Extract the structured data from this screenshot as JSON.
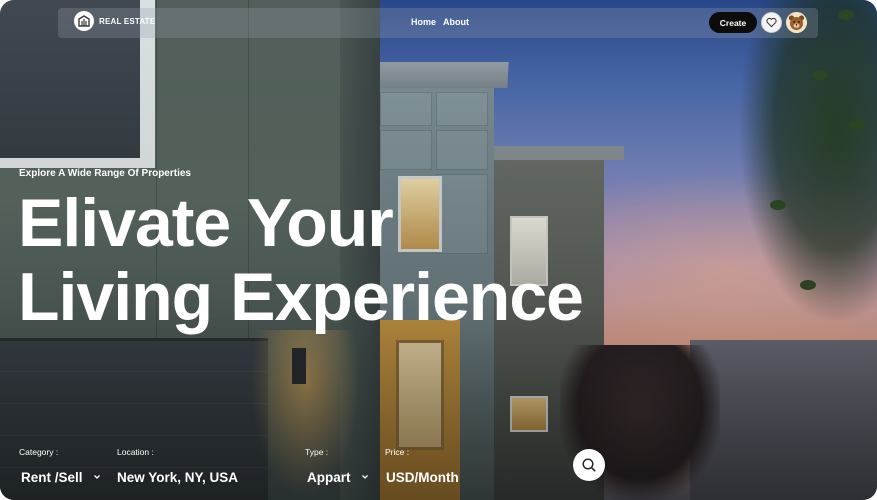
{
  "nav": {
    "brand": "REAL ESTATE",
    "links": [
      {
        "label": "Home"
      },
      {
        "label": "About"
      }
    ],
    "create_label": "Create",
    "favorite_icon": "heart-icon",
    "avatar_icon": "bear-avatar"
  },
  "hero": {
    "eyebrow": "Explore A Wide Range Of Properties",
    "title_line1": "Elivate Your",
    "title_line2": "Living Experience"
  },
  "search": {
    "category": {
      "label": "Category :",
      "value": "Rent /Sell"
    },
    "location": {
      "label": "Location :",
      "value": "New York, NY, USA"
    },
    "type": {
      "label": "Type :",
      "value": "Appart"
    },
    "price": {
      "label": "Price :",
      "value": "USD/Month"
    },
    "button_icon": "search-icon"
  },
  "colors": {
    "text": "#ffffff",
    "button_dark": "#0c0c0c"
  }
}
